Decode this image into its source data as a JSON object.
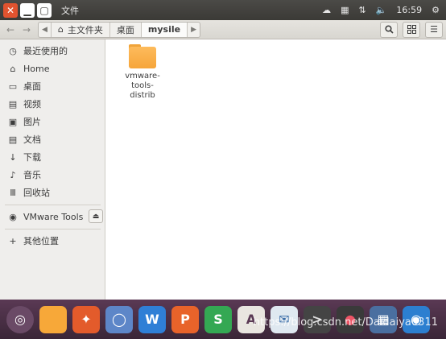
{
  "window": {
    "title": "文件",
    "close_icon": "close-icon",
    "minimize_icon": "minimize-icon",
    "maximize_icon": "maximize-icon"
  },
  "tray": {
    "time": "16:59",
    "icons": [
      "dropbox-icon",
      "keyboard-icon",
      "network-icon",
      "volume-icon",
      "gear-icon"
    ]
  },
  "toolbar": {
    "breadcrumbs": [
      {
        "label": "主文件夹",
        "icon": "home-icon"
      },
      {
        "label": "桌面"
      },
      {
        "label": "mysile"
      }
    ]
  },
  "sidebar": {
    "items": [
      {
        "label": "最近使用的",
        "icon": "clock-icon"
      },
      {
        "label": "Home",
        "icon": "home-icon"
      },
      {
        "label": "桌面",
        "icon": "desktop-icon"
      },
      {
        "label": "视频",
        "icon": "film-icon"
      },
      {
        "label": "图片",
        "icon": "picture-icon"
      },
      {
        "label": "文档",
        "icon": "document-icon"
      },
      {
        "label": "下载",
        "icon": "download-icon"
      },
      {
        "label": "音乐",
        "icon": "music-icon"
      },
      {
        "label": "回收站",
        "icon": "trash-icon"
      }
    ],
    "devices": [
      {
        "label": "VMware Tools",
        "icon": "disc-icon",
        "eject_icon": "eject-icon"
      }
    ],
    "other": {
      "label": "其他位置",
      "icon": "plus-icon"
    }
  },
  "content": {
    "files": [
      {
        "name": "vmware-\ntools-\ndistrib",
        "icon": "folder-icon"
      }
    ]
  },
  "dock": {
    "items": [
      "ubuntu-icon",
      "files-icon",
      "firefox-icon",
      "chromium-icon",
      "wps-writer-icon",
      "wps-presentation-icon",
      "wps-spreadsheet-icon",
      "software-center-icon",
      "mail-icon",
      "terminal-icon",
      "media-icon",
      "workspace-icon",
      "dvd-icon"
    ],
    "watermark": "https://blog.csdn.net/Daidaiya0311"
  },
  "colors": {
    "accent": "#e2532f",
    "folder": "#f7a839",
    "panel": "#3b3a36",
    "dock": "#4a3045"
  }
}
